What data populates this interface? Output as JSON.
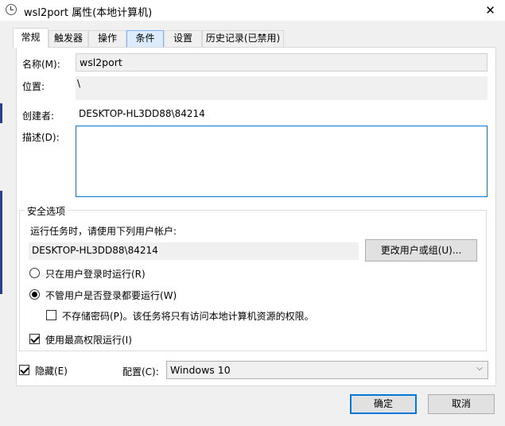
{
  "window": {
    "title": "wsl2port 属性(本地计算机)",
    "close_glyph": "✕"
  },
  "tabs": [
    {
      "label": "常规",
      "active": true
    },
    {
      "label": "触发器"
    },
    {
      "label": "操作"
    },
    {
      "label": "条件",
      "hover": true
    },
    {
      "label": "设置"
    },
    {
      "label": "历史记录(已禁用)"
    }
  ],
  "general": {
    "name_label": "名称(M):",
    "name_value": "wsl2port",
    "location_label": "位置:",
    "location_value": "\\",
    "author_label": "创建者:",
    "author_value": "DESKTOP-HL3DD88\\84214",
    "description_label": "描述(D):",
    "description_value": ""
  },
  "security": {
    "legend": "安全选项",
    "run_as_label": "运行任务时，请使用下列用户帐户:",
    "run_as_value": "DESKTOP-HL3DD88\\84214",
    "change_user_button": "更改用户或组(U)...",
    "radio_logged_on": "只在用户登录时运行(R)",
    "radio_whether_logged_on": "不管用户是否登录都要运行(W)",
    "selected_radio": "whether_logged_on",
    "no_store_password": "不存储密码(P)。该任务将只有访问本地计算机资源的权限。",
    "no_store_password_checked": false,
    "highest_privileges": "使用最高权限运行(I)",
    "highest_privileges_checked": true
  },
  "footer": {
    "hidden_label": "隐藏(E)",
    "hidden_checked": true,
    "configure_label": "配置(C):",
    "configure_value": "Windows 10",
    "ok_button": "确定",
    "cancel_button": "取消"
  },
  "colors": {
    "accent": "#0078d7",
    "dialog_bg": "#f0f0f0",
    "panel_bg": "#ffffff"
  }
}
